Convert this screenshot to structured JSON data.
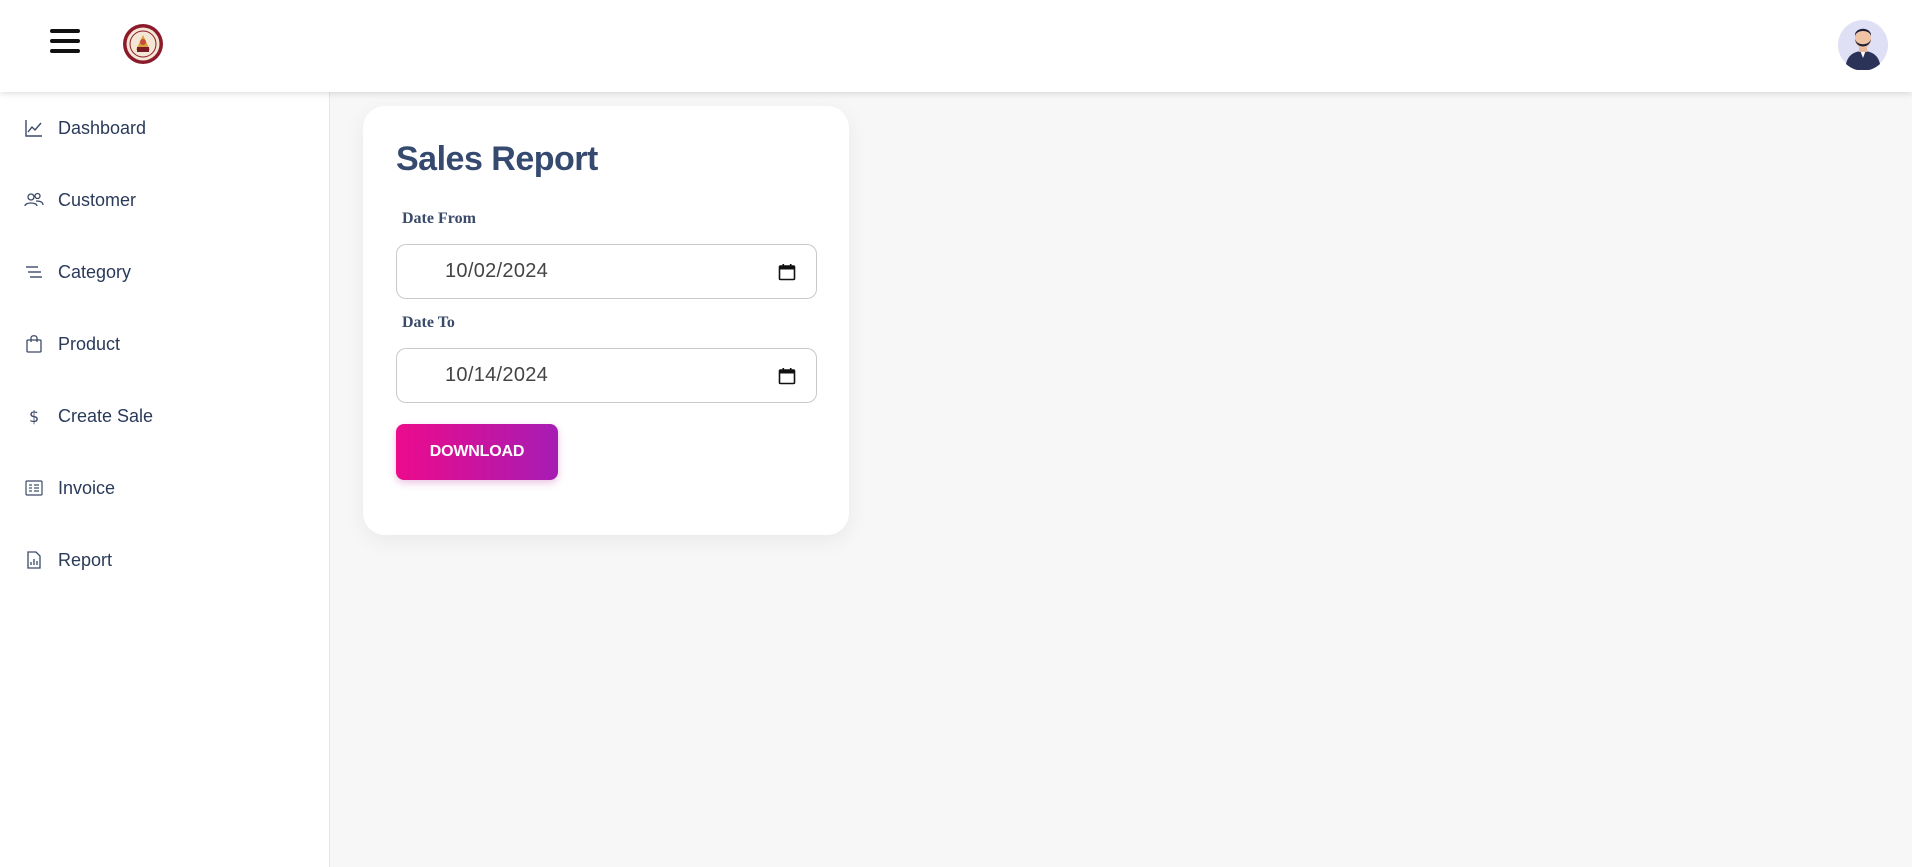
{
  "header": {
    "menu_icon": "hamburger-icon",
    "logo_icon": "institution-seal-logo",
    "avatar_icon": "user-avatar"
  },
  "sidebar": {
    "items": [
      {
        "label": "Dashboard",
        "icon": "chart-line-icon"
      },
      {
        "label": "Customer",
        "icon": "users-icon"
      },
      {
        "label": "Category",
        "icon": "list-lines-icon"
      },
      {
        "label": "Product",
        "icon": "shopping-bag-icon"
      },
      {
        "label": "Create Sale",
        "icon": "dollar-icon"
      },
      {
        "label": "Invoice",
        "icon": "invoice-icon"
      },
      {
        "label": "Report",
        "icon": "report-file-icon"
      }
    ]
  },
  "report": {
    "title": "Sales Report",
    "date_from_label": "Date From",
    "date_from_value": "10/02/2024",
    "date_to_label": "Date To",
    "date_to_value": "10/14/2024",
    "download_label": "DOWNLOAD"
  },
  "colors": {
    "button_gradient_start": "#ec0b8c",
    "button_gradient_end": "#a61cb4",
    "title": "#354a6e"
  }
}
